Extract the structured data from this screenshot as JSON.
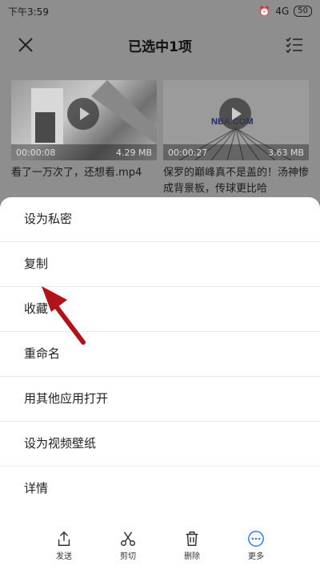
{
  "status": {
    "time": "下午3:59",
    "network": "4G",
    "battery": "50"
  },
  "header": {
    "title": "已选中1项"
  },
  "videos": [
    {
      "duration": "00:00:08",
      "size": "4.29 MB",
      "name": "看了一万次了，还想看.mp4"
    },
    {
      "duration": "00:00:27",
      "size": "3.63 MB",
      "name": "保罗的巅峰真不是盖的！汤神惨成背景板，传球更比哈"
    }
  ],
  "thumb_text": {
    "nba": "NBA.COM"
  },
  "menu": [
    "设为私密",
    "复制",
    "收藏",
    "重命名",
    "用其他应用打开",
    "设为视频壁纸",
    "详情"
  ],
  "toolbar": {
    "send": "发送",
    "cut": "剪切",
    "delete": "删除",
    "more": "更多"
  },
  "colors": {
    "arrow": "#b3121b",
    "overlay": "#8e8e8e",
    "more_accent": "#2f7cf6"
  },
  "icons": [
    "close-icon",
    "checklist-icon",
    "play-icon",
    "share-icon",
    "scissors-icon",
    "trash-icon",
    "more-icon"
  ]
}
